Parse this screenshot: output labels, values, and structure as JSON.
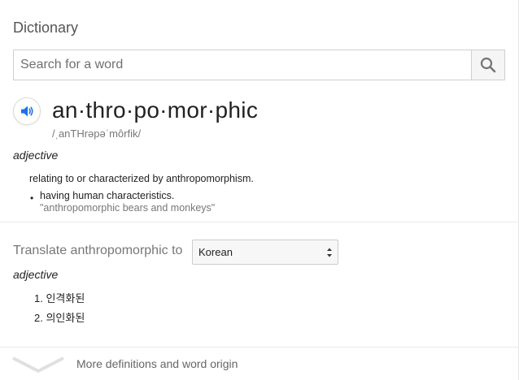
{
  "widget": {
    "title": "Dictionary"
  },
  "search": {
    "placeholder": "Search for a word",
    "value": ""
  },
  "entry": {
    "headword": "an·thro·po·mor·phic",
    "phonetic": "/ˌanTHrəpəˈmôrfik/",
    "part_of_speech": "adjective",
    "definition": "relating to or characterized by anthropomorphism.",
    "sub_definition": "having human characteristics.",
    "bullet": "•",
    "example": "\"anthropomorphic bears and monkeys\""
  },
  "translate": {
    "label": "Translate anthropomorphic to",
    "selected_language": "Korean",
    "part_of_speech": "adjective",
    "items": [
      "1. 인격화된",
      "2. 의인화된"
    ]
  },
  "footer": {
    "more_label": "More definitions and word origin"
  },
  "colors": {
    "accent_blue": "#1a73e8",
    "icon_gray": "#757575",
    "chevron_gray": "#e0e0e0"
  }
}
